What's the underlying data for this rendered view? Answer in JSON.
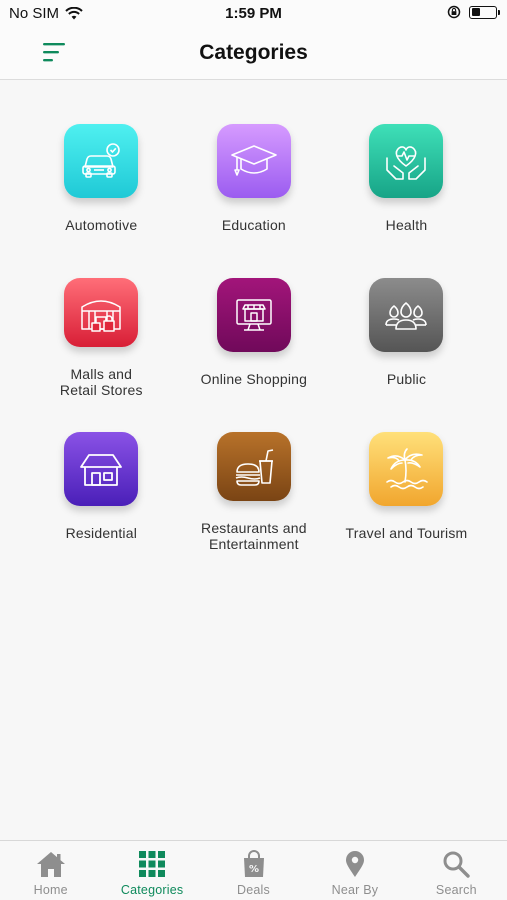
{
  "status": {
    "carrier": "No SIM",
    "time": "1:59 PM"
  },
  "header": {
    "title": "Categories"
  },
  "colors": {
    "accent": "#0f8a5c",
    "inactive": "#8e8e8e"
  },
  "categories": [
    {
      "label": "Automotive",
      "icon": "car-icon",
      "color_top": "#4ff0f0",
      "color_bottom": "#1fc9d6"
    },
    {
      "label": "Education",
      "icon": "graduation-cap-icon",
      "color_top": "#d69bff",
      "color_bottom": "#9b5cf0"
    },
    {
      "label": "Health",
      "icon": "heart-hands-icon",
      "color_top": "#3fe0b8",
      "color_bottom": "#17a487"
    },
    {
      "label": "Malls and\nRetail Stores",
      "icon": "mall-icon",
      "color_top": "#ff6e78",
      "color_bottom": "#d81e36"
    },
    {
      "label": "Online Shopping",
      "icon": "online-store-icon",
      "color_top": "#a2157a",
      "color_bottom": "#70095a"
    },
    {
      "label": "Public",
      "icon": "people-icon",
      "color_top": "#8c8c8c",
      "color_bottom": "#555555"
    },
    {
      "label": "Residential",
      "icon": "house-icon",
      "color_top": "#8a52e6",
      "color_bottom": "#4a1fb8"
    },
    {
      "label": "Restaurants and\nEntertainment",
      "icon": "burger-drink-icon",
      "color_top": "#b8722a",
      "color_bottom": "#7a4414"
    },
    {
      "label": "Travel and Tourism",
      "icon": "palm-tree-icon",
      "color_top": "#ffe07a",
      "color_bottom": "#f1a62e"
    }
  ],
  "tabs": [
    {
      "label": "Home",
      "icon": "home-icon",
      "active": false
    },
    {
      "label": "Categories",
      "icon": "grid-icon",
      "active": true
    },
    {
      "label": "Deals",
      "icon": "deals-bag-icon",
      "active": false
    },
    {
      "label": "Near By",
      "icon": "location-pin-icon",
      "active": false
    },
    {
      "label": "Search",
      "icon": "search-icon",
      "active": false
    }
  ]
}
